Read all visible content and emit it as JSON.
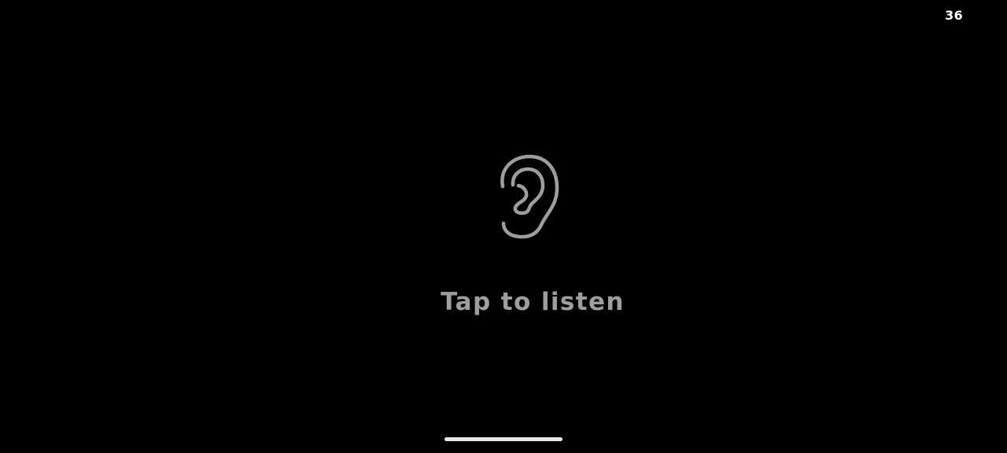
{
  "status_bar": {
    "number": "36"
  },
  "main": {
    "icon": "ear-icon",
    "label": "Tap to listen"
  },
  "colors": {
    "background": "#000000",
    "icon": "#9e9e9e",
    "label": "#9e9e9e",
    "status_text": "#ffffff",
    "home_indicator": "#e6e6e6"
  }
}
